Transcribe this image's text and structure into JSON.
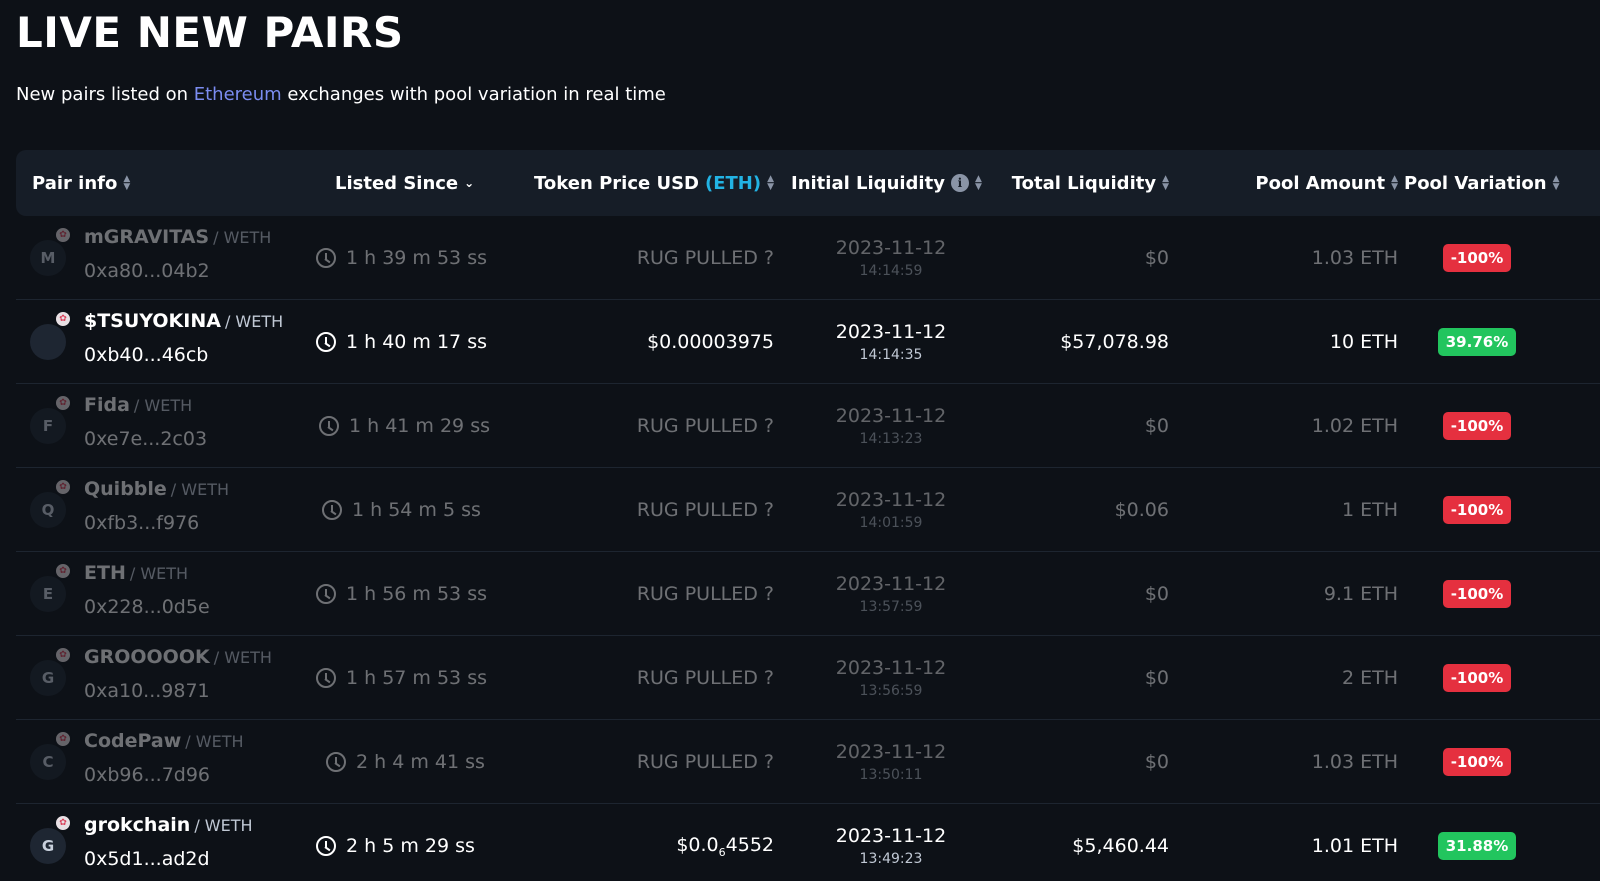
{
  "header": {
    "title": "LIVE NEW PAIRS",
    "subtitle_before": "New pairs listed on ",
    "subtitle_link": "Ethereum",
    "subtitle_after": " exchanges with pool variation in real time"
  },
  "columns": {
    "pair_info": "Pair info",
    "listed_since": "Listed Since",
    "token_price": "Token Price USD",
    "token_price_accent": "(ETH)",
    "initial_liquidity": "Initial Liquidity",
    "total_liquidity": "Total Liquidity",
    "pool_amount": "Pool Amount",
    "pool_variation": "Pool Variation"
  },
  "rows": [
    {
      "initial": "M",
      "name": "mGRAVITAS",
      "base": "/ WETH",
      "addr": "0xa80...04b2",
      "since": "1 h 39 m 53 ss",
      "price": "RUG PULLED ?",
      "date": "2023-11-12",
      "time": "14:14:59",
      "total": "$0",
      "pool": "1.03 ETH",
      "variation": "-100%"
    },
    {
      "initial": "",
      "name": "$TSUYOKINA",
      "base": "/ WETH",
      "addr": "0xb40...46cb",
      "since": "1 h 40 m 17 ss",
      "price": "$0.00003975",
      "date": "2023-11-12",
      "time": "14:14:35",
      "total": "$57,078.98",
      "pool": "10 ETH",
      "variation": "39.76%"
    },
    {
      "initial": "F",
      "name": "Fida",
      "base": "/ WETH",
      "addr": "0xe7e...2c03",
      "since": "1 h 41 m 29 ss",
      "price": "RUG PULLED ?",
      "date": "2023-11-12",
      "time": "14:13:23",
      "total": "$0",
      "pool": "1.02 ETH",
      "variation": "-100%"
    },
    {
      "initial": "Q",
      "name": "Quibble",
      "base": "/ WETH",
      "addr": "0xfb3...f976",
      "since": "1 h 54 m 5 ss",
      "price": "RUG PULLED ?",
      "date": "2023-11-12",
      "time": "14:01:59",
      "total": "$0.06",
      "pool": "1 ETH",
      "variation": "-100%"
    },
    {
      "initial": "E",
      "name": "ETH",
      "base": "/ WETH",
      "addr": "0x228...0d5e",
      "since": "1 h 56 m 53 ss",
      "price": "RUG PULLED ?",
      "date": "2023-11-12",
      "time": "13:57:59",
      "total": "$0",
      "pool": "9.1 ETH",
      "variation": "-100%"
    },
    {
      "initial": "G",
      "name": "GROOOOOK",
      "base": "/ WETH",
      "addr": "0xa10...9871",
      "since": "1 h 57 m 53 ss",
      "price": "RUG PULLED ?",
      "date": "2023-11-12",
      "time": "13:56:59",
      "total": "$0",
      "pool": "2 ETH",
      "variation": "-100%"
    },
    {
      "initial": "C",
      "name": "CodePaw",
      "base": "/ WETH",
      "addr": "0xb96...7d96",
      "since": "2 h 4 m 41 ss",
      "price": "RUG PULLED ?",
      "date": "2023-11-12",
      "time": "13:50:11",
      "total": "$0",
      "pool": "1.03 ETH",
      "variation": "-100%"
    },
    {
      "initial": "G",
      "name": "grokchain",
      "base": "/ WETH",
      "addr": "0x5d1...ad2d",
      "since": "2 h 5 m 29 ss",
      "price_main": "$0.0",
      "price_sub": "6",
      "price_tail": "4552",
      "date": "2023-11-12",
      "time": "13:49:23",
      "total": "$5,460.44",
      "pool": "1.01 ETH",
      "variation": "31.88%"
    }
  ],
  "colors": {
    "background": "#0d1117",
    "header_row": "#161d27",
    "link": "#7b8cf0",
    "accent": "#22b3e4",
    "negative": "#e5303f",
    "positive": "#22c55e"
  }
}
